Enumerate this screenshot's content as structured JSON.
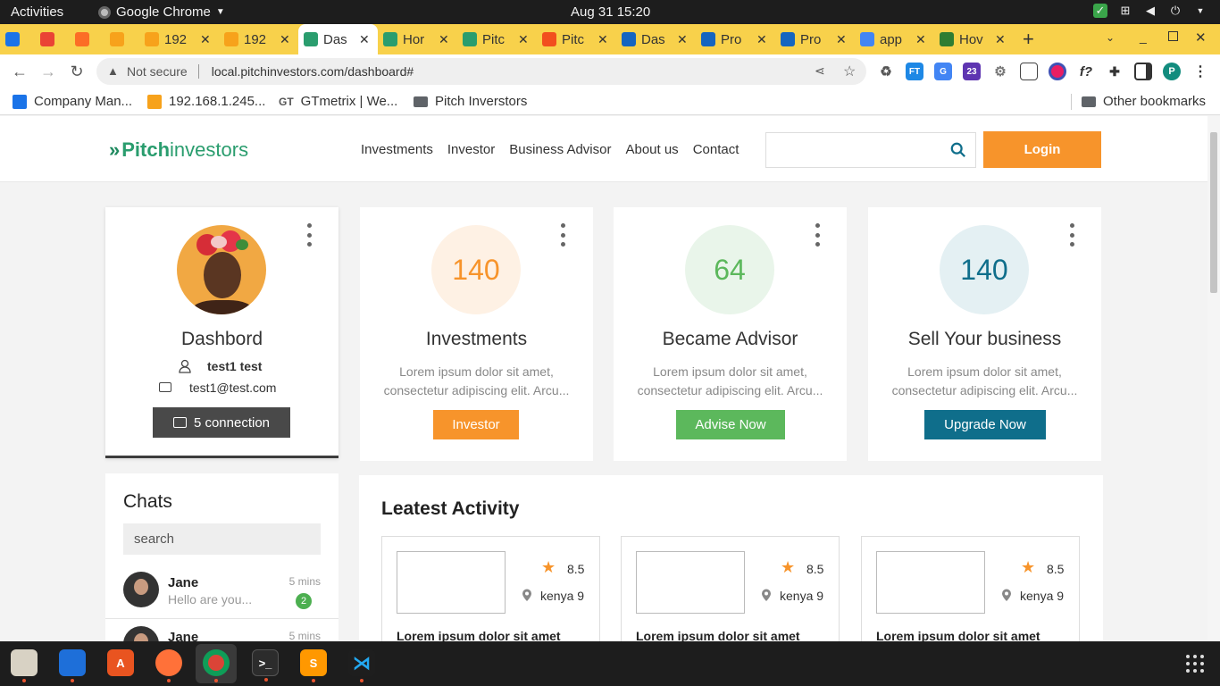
{
  "os": {
    "activities": "Activities",
    "app_name": "Google Chrome",
    "clock": "Aug 31  15:20"
  },
  "tabs": [
    {
      "label": "",
      "icon": "app-icon",
      "color": "#1a73e8"
    },
    {
      "label": "",
      "icon": "gmail-icon",
      "color": "#ea4335"
    },
    {
      "label": "",
      "icon": "gitlab-icon",
      "color": "#fc6d26"
    },
    {
      "label": "",
      "icon": "pma-icon",
      "color": "#f7a21b"
    },
    {
      "label": "192",
      "icon": "pma-icon",
      "color": "#f7a21b"
    },
    {
      "label": "192",
      "icon": "pma-icon",
      "color": "#f7a21b"
    },
    {
      "label": "Das",
      "icon": "pitch-icon",
      "color": "#2a9d6e",
      "active": true
    },
    {
      "label": "Hor",
      "icon": "pitch-icon",
      "color": "#2a9d6e"
    },
    {
      "label": "Pitc",
      "icon": "pitch-icon",
      "color": "#2a9d6e"
    },
    {
      "label": "Pitc",
      "icon": "figma-icon",
      "color": "#f24e1e"
    },
    {
      "label": "Das",
      "icon": "chart-icon",
      "color": "#1565c0"
    },
    {
      "label": "Pro",
      "icon": "chart-icon",
      "color": "#1565c0"
    },
    {
      "label": "Pro",
      "icon": "chart-icon",
      "color": "#1565c0"
    },
    {
      "label": "app",
      "icon": "google-icon",
      "color": "#4285f4"
    },
    {
      "label": "Hov",
      "icon": "link-icon",
      "color": "#2e7d32"
    }
  ],
  "address": {
    "not_secure": "Not secure",
    "url": "local.pitchinvestors.com/dashboard#"
  },
  "bookmarks": [
    {
      "label": "Company Man..."
    },
    {
      "label": "192.168.1.245..."
    },
    {
      "label": "GTmetrix | We..."
    },
    {
      "label": "Pitch Inverstors"
    }
  ],
  "other_bookmarks": "Other bookmarks",
  "site": {
    "logo_a": "Pitch",
    "logo_b": "investors",
    "nav": [
      "Investments",
      "Investor",
      "Business Advisor",
      "About us",
      "Contact"
    ],
    "login": "Login"
  },
  "profile": {
    "title": "Dashbord",
    "name": "test1 test",
    "email": "test1@test.com",
    "connections": "5 connection"
  },
  "stats": [
    {
      "value": "140",
      "title": "Investments",
      "desc": "Lorem ipsum dolor sit amet, consectetur adipiscing elit. Arcu...",
      "button": "Investor",
      "color": "#f7942b",
      "bg": "#fef1e4"
    },
    {
      "value": "64",
      "title": "Became Advisor",
      "desc": "Lorem ipsum dolor sit amet, consectetur adipiscing elit. Arcu...",
      "button": "Advise Now",
      "color": "#5cb85c",
      "bg": "#e9f5ea"
    },
    {
      "value": "140",
      "title": "Sell Your business",
      "desc": "Lorem ipsum dolor sit amet, consectetur adipiscing elit. Arcu...",
      "button": "Upgrade Now",
      "color": "#0f6e8b",
      "bg": "#e4f0f3"
    }
  ],
  "chats": {
    "title": "Chats",
    "search_placeholder": "search",
    "items": [
      {
        "name": "Jane",
        "message": "Hello are you...",
        "time": "5 mins",
        "badge": "2"
      },
      {
        "name": "Jane",
        "message": "",
        "time": "5 mins",
        "badge": ""
      }
    ]
  },
  "activity": {
    "title": "Leatest Activity",
    "cards": [
      {
        "rating": "8.5",
        "location": "kenya 9",
        "title": "Lorem ipsum dolor sit amet"
      },
      {
        "rating": "8.5",
        "location": "kenya 9",
        "title": "Lorem ipsum dolor sit amet"
      },
      {
        "rating": "8.5",
        "location": "kenya 9",
        "title": "Lorem ipsum dolor sit amet"
      }
    ]
  }
}
